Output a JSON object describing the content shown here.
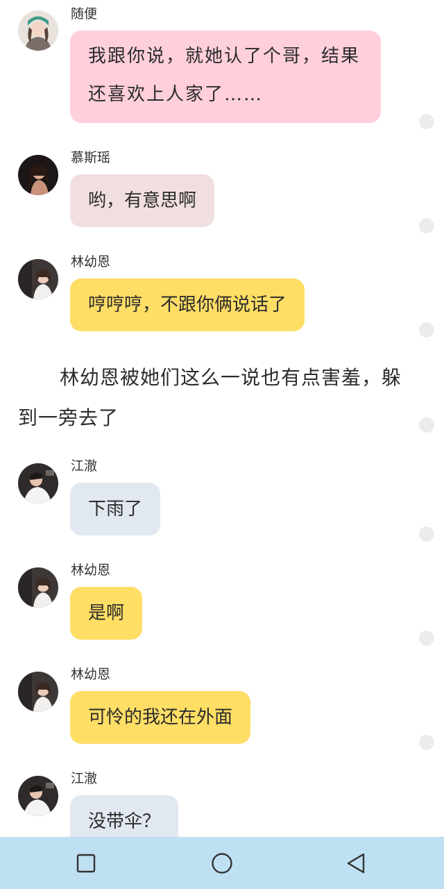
{
  "messages": [
    {
      "name": "随便",
      "text": "我跟你说，就她认了个哥，结果还喜欢上人家了……",
      "color": "#ffcfdb",
      "avatar": "avatar-suibian"
    },
    {
      "name": "慕斯瑶",
      "text": "哟，有意思啊",
      "color": "#f1dfdf",
      "avatar": "avatar-musiyao"
    },
    {
      "name": "林幼恩",
      "text": "哼哼哼，不跟你俩说话了",
      "color": "#ffde66",
      "avatar": "avatar-linyouen"
    },
    {
      "name": "江澈",
      "text": "下雨了",
      "color": "#e2e8f0",
      "avatar": "avatar-jiangche"
    },
    {
      "name": "林幼恩",
      "text": "是啊",
      "color": "#ffde66",
      "avatar": "avatar-linyouen"
    },
    {
      "name": "林幼恩",
      "text": "可怜的我还在外面",
      "color": "#ffde66",
      "avatar": "avatar-linyouen"
    },
    {
      "name": "江澈",
      "text": "没带伞？",
      "color": "#e2e8f0",
      "avatar": "avatar-jiangche"
    }
  ],
  "narration": "林幼恩被她们这么一说也有点害羞，躲到一旁去了",
  "navbar": {
    "background": "#bfe0f2",
    "buttons": [
      "recent-apps-icon",
      "home-icon",
      "back-icon"
    ]
  }
}
